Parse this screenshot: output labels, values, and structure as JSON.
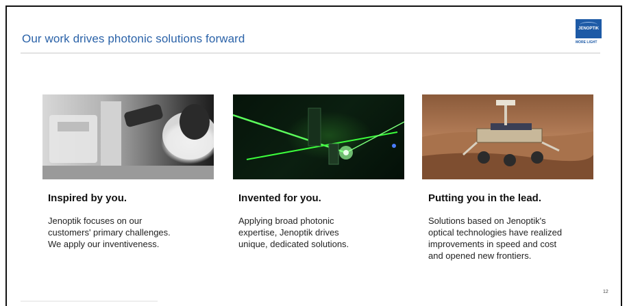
{
  "slide": {
    "title": "Our work drives photonic solutions forward",
    "page_number": "12"
  },
  "logo": {
    "name": "JENOPTIK",
    "tagline": "MORE LIGHT",
    "brand_color": "#1d5aa6"
  },
  "columns": [
    {
      "image": "microscope-researcher-photo",
      "heading": "Inspired by you.",
      "lines": [
        "Jenoptik focuses on our",
        "customers' primary challenges.",
        "We apply our inventiveness."
      ]
    },
    {
      "image": "green-laser-optics-photo",
      "heading": "Invented for you.",
      "lines": [
        "Applying broad photonic",
        "expertise, Jenoptik drives",
        "unique, dedicated solutions."
      ]
    },
    {
      "image": "mars-rover-photo",
      "heading": "Putting you in the lead.",
      "lines": [
        "Solutions based on Jenoptik's",
        "optical technologies have realized",
        "improvements in speed and cost",
        "and opened new frontiers."
      ]
    }
  ],
  "colors": {
    "title_blue": "#2a62a8",
    "text": "#222222"
  }
}
